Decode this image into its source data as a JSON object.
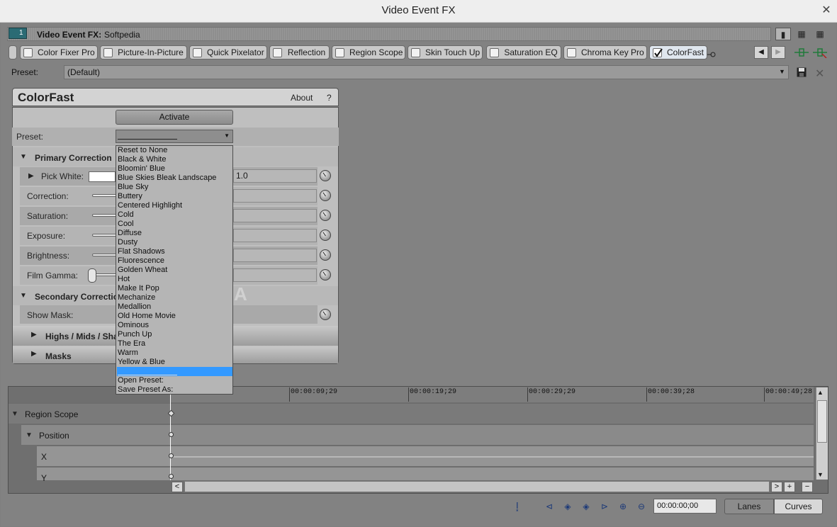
{
  "window": {
    "title": "Video Event FX",
    "close_glyph": "✕"
  },
  "header": {
    "track_number": "1",
    "label": "Video Event FX:",
    "value": "Softpedia"
  },
  "fx_chain": [
    {
      "label": "Color Fixer Pro",
      "checked": false
    },
    {
      "label": "Picture-In-Picture",
      "checked": false
    },
    {
      "label": "Quick Pixelator",
      "checked": false
    },
    {
      "label": "Reflection",
      "checked": false
    },
    {
      "label": "Region Scope",
      "checked": false
    },
    {
      "label": "Skin Touch Up",
      "checked": false
    },
    {
      "label": "Saturation EQ",
      "checked": false
    },
    {
      "label": "Chroma Key Pro",
      "checked": false
    },
    {
      "label": "ColorFast",
      "checked": true
    }
  ],
  "preset_row": {
    "label": "Preset:",
    "value": "(Default)"
  },
  "plugin": {
    "title": "ColorFast",
    "about": "About",
    "help": "?",
    "activate": "Activate",
    "preset_label": "Preset:",
    "primary_section": "Primary Correction",
    "params": [
      {
        "label": "Pick White:",
        "value": "1.0"
      },
      {
        "label": "Correction:",
        "value": ""
      },
      {
        "label": "Saturation:",
        "value": ""
      },
      {
        "label": "Exposure:",
        "value": ""
      },
      {
        "label": "Brightness:",
        "value": ""
      },
      {
        "label": "Film Gamma:",
        "value": ""
      }
    ],
    "secondary_section": "Secondary Correction",
    "show_mask": "Show Mask:",
    "highs_section": "Highs / Mids / Sha",
    "masks_section": "Masks"
  },
  "dropdown": {
    "items": [
      "Reset to None",
      "Black & White",
      "Bloomin' Blue",
      "Blue Skies Bleak Landscape",
      "Blue Sky",
      "Buttery",
      "Centered Highlight",
      "Cold",
      "Cool",
      "Diffuse",
      "Dusty",
      "Flat Shadows",
      "Fluorescence",
      "Golden Wheat",
      "Hot",
      "Make It Pop",
      "Mechanize",
      "Medallion",
      "Old Home Movie",
      "Ominous",
      "Punch Up",
      "The Era",
      "Warm",
      "Yellow & Blue"
    ],
    "open_preset": "Open Preset:",
    "save_preset": "Save Preset As:"
  },
  "timeline": {
    "ticks": [
      "00:00:09;29",
      "00:00:19;29",
      "00:00:29;29",
      "00:00:39;28",
      "00:00:49;28"
    ],
    "rows": [
      "Region Scope",
      "Position",
      "X",
      "Y"
    ]
  },
  "bottom": {
    "time": "00:00:00;00",
    "lanes": "Lanes",
    "curves": "Curves"
  },
  "colors": {
    "selection": "#3399ff",
    "accent": "#2b6b74"
  }
}
